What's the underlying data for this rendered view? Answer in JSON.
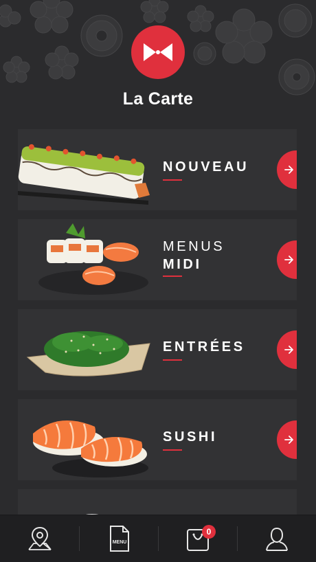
{
  "header": {
    "title": "La Carte"
  },
  "menu": {
    "items": [
      {
        "line1": "NOUVEAU",
        "line2": ""
      },
      {
        "line1": "MENUS",
        "line2": "MIDI"
      },
      {
        "line1": "ENTRÉES",
        "line2": ""
      },
      {
        "line1": "SUSHI",
        "line2": ""
      }
    ]
  },
  "bottom_nav": {
    "items": [
      {
        "icon": "map-pin-icon"
      },
      {
        "icon": "menu-document-icon",
        "label": "MENU"
      },
      {
        "icon": "cart-icon",
        "badge": "0"
      },
      {
        "icon": "user-icon"
      }
    ]
  },
  "colors": {
    "accent": "#e0303d",
    "background": "#2b2b2d",
    "card": "#323234",
    "nav": "#1f1f21"
  }
}
